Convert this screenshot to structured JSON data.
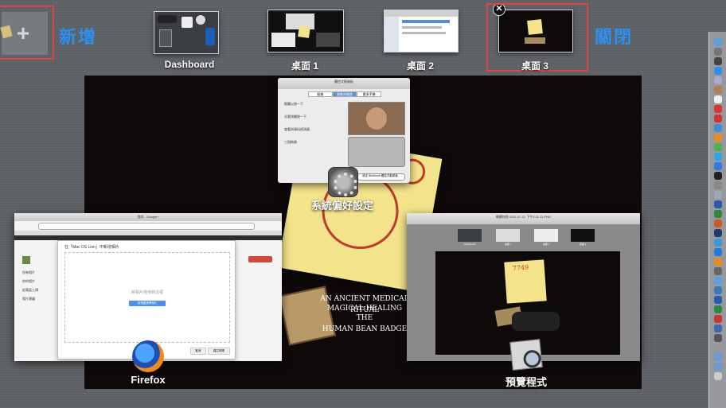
{
  "spaces_bar": {
    "add_label": "新增",
    "close_label": "關閉",
    "spaces": [
      {
        "id": "dashboard",
        "label": "Dashboard"
      },
      {
        "id": "desktop1",
        "label": "桌面 1"
      },
      {
        "id": "desktop2",
        "label": "桌面 2"
      },
      {
        "id": "desktop3",
        "label": "桌面 3"
      }
    ]
  },
  "windows": {
    "sysprefs": {
      "app_label": "系統偏好設定",
      "title": "觸控式軌跡板",
      "tabs": [
        "點按",
        "捲動與縮放",
        "更多手勢"
      ],
      "options": [
        "輕觸以按一下",
        "次要按鍵按一下",
        "查看與資料偵測器",
        "三指拖移"
      ],
      "bluetooth_button": "設定 Bluetooth 觸控式軌跡板..."
    },
    "firefox": {
      "app_label": "Firefox",
      "title": "我的 - Google+",
      "dialog_title": "在「Mac OS Lion」中新增相片",
      "drop_text": "將相片拖曳到這裡",
      "upload_button": "從電腦選擇相片",
      "cancel": "取消",
      "confirm": "建立相簿",
      "sidebar_items": [
        "所有相片",
        "你的相片",
        "從電話上傳",
        "相片建議"
      ]
    },
    "preview": {
      "app_label": "預覽程式",
      "title": "螢幕快照 2011-07-21 下午3.22.11.PNG",
      "mini_spaces": [
        "Dashboard",
        "桌面 1",
        "桌面 2",
        "桌面 3"
      ]
    }
  },
  "wallpaper": {
    "number": "7749",
    "lines": [
      "AN ANCIENT MEDICAL RITUAL",
      "MAGICAL HEALING",
      "THE",
      "HUMAN BEAN BADGE"
    ]
  },
  "colors": {
    "accent_blue": "#2d8ff0",
    "highlight_red": "#e0443e",
    "desktop_bg": "#0e0a0a",
    "note_yellow": "#f3e38a"
  }
}
